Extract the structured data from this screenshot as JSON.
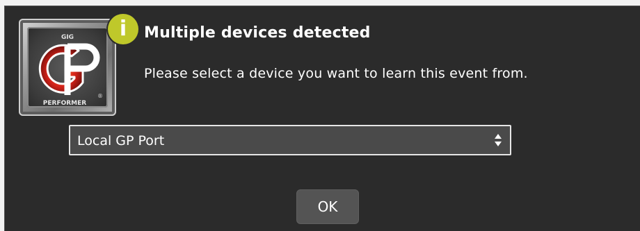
{
  "dialog": {
    "title": "Multiple devices detected",
    "message": "Please select a device you want to learn this event from.",
    "info_icon": "info-icon",
    "info_glyph": "i",
    "accent_color": "#bfc82a"
  },
  "logo": {
    "top_text": "GIG",
    "monogram": "GP",
    "bottom_text": "PERFORMER",
    "registered": "®"
  },
  "device_select": {
    "selected": "Local GP Port",
    "icon": "updown-arrows-icon"
  },
  "buttons": {
    "ok_label": "OK"
  }
}
